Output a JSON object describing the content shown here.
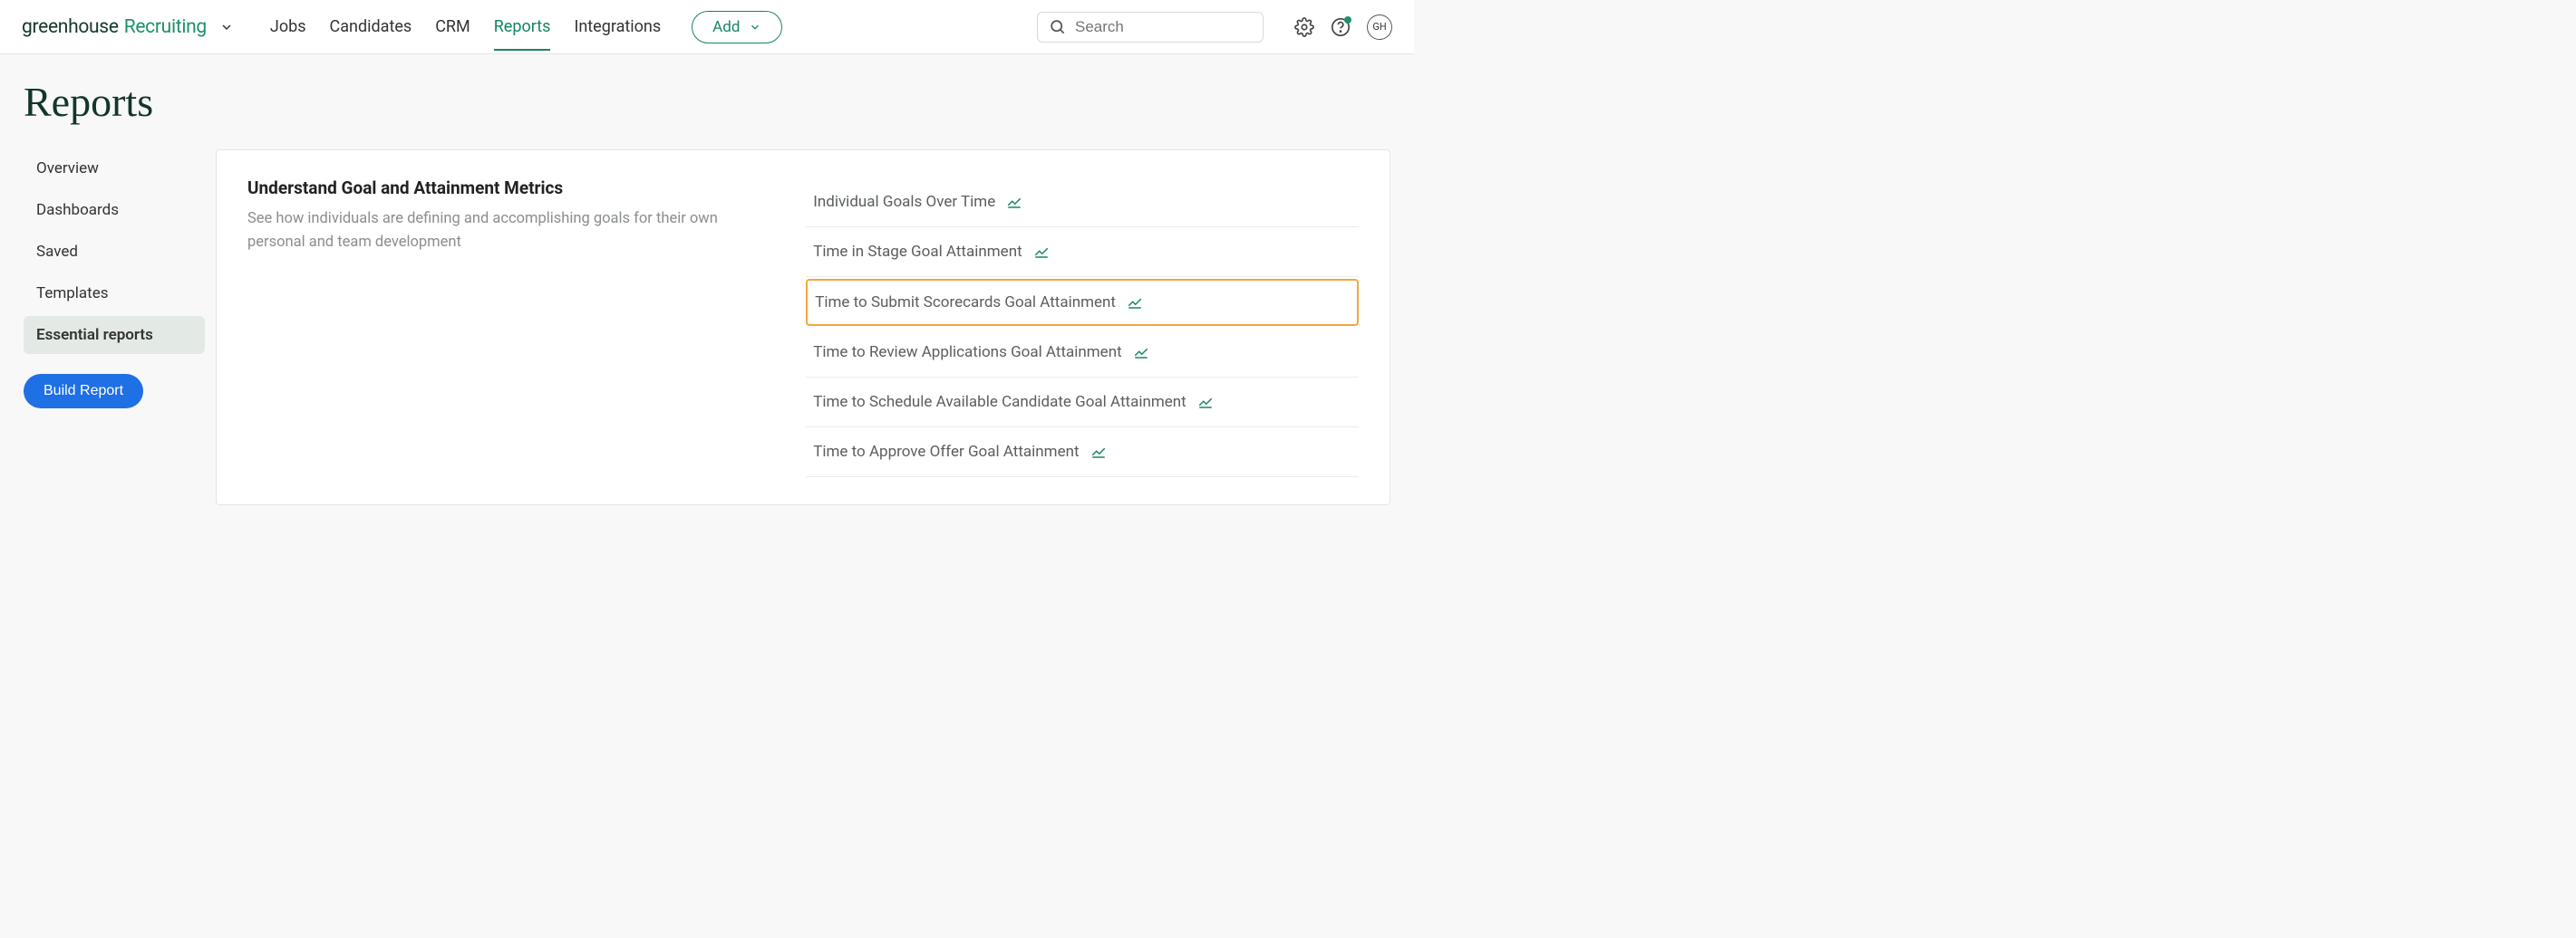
{
  "brand": {
    "part1": "greenhouse",
    "part2": "Recruiting"
  },
  "nav": {
    "jobs": "Jobs",
    "candidates": "Candidates",
    "crm": "CRM",
    "reports": "Reports",
    "integrations": "Integrations"
  },
  "add_label": "Add",
  "search_placeholder": "Search",
  "avatar_initials": "GH",
  "page_title": "Reports",
  "sidebar": {
    "overview": "Overview",
    "dashboards": "Dashboards",
    "saved": "Saved",
    "templates": "Templates",
    "essential": "Essential reports",
    "build": "Build Report"
  },
  "section": {
    "title": "Understand Goal and Attainment Metrics",
    "desc": "See how individuals are defining and accomplishing goals for their own personal and team development"
  },
  "reports": [
    {
      "label": "Individual Goals Over Time",
      "highlight": false
    },
    {
      "label": "Time in Stage Goal Attainment",
      "highlight": false
    },
    {
      "label": "Time to Submit Scorecards Goal Attainment",
      "highlight": true
    },
    {
      "label": "Time to Review Applications Goal Attainment",
      "highlight": false
    },
    {
      "label": "Time to Schedule Available Candidate Goal Attainment",
      "highlight": false
    },
    {
      "label": "Time to Approve Offer Goal Attainment",
      "highlight": false
    }
  ]
}
